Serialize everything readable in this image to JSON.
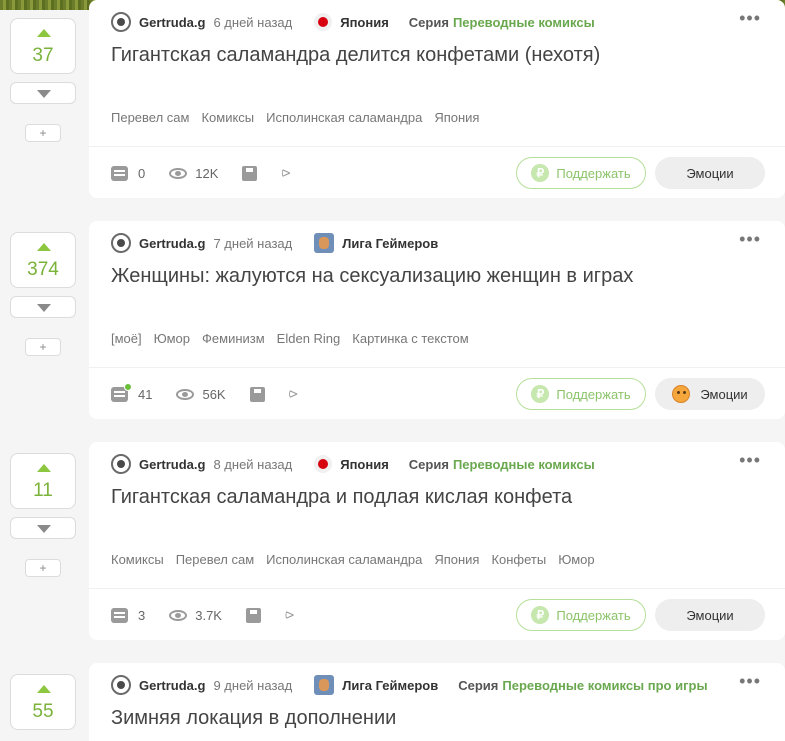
{
  "posts": [
    {
      "score": "37",
      "author": "Gertruda.g",
      "time": "6 дней назад",
      "community": "Япония",
      "community_icon": "japan-flag-icon",
      "series_label": "Серия",
      "series_name": "Переводные комиксы",
      "title": "Гигантская саламандра делится конфетами (нехотя)",
      "tags": [
        "Перевел сам",
        "Комиксы",
        "Исполинская саламандра",
        "Япония"
      ],
      "comments": "0",
      "views": "12K",
      "support_label": "Поддержать",
      "emotions_label": "Эмоции",
      "emotions_icon": ""
    },
    {
      "score": "374",
      "author": "Gertruda.g",
      "time": "7 дней назад",
      "community": "Лига Геймеров",
      "community_icon": "gamer-league-icon",
      "series_label": "",
      "series_name": "",
      "title": "Женщины: жалуются на сексуализацию женщин в играх",
      "tags": [
        "[моё]",
        "Юмор",
        "Феминизм",
        "Elden Ring",
        "Картинка с текстом"
      ],
      "comments": "41",
      "views": "56K",
      "support_label": "Поддержать",
      "emotions_label": "Эмоции",
      "emotions_icon": "laughing-face-icon"
    },
    {
      "score": "11",
      "author": "Gertruda.g",
      "time": "8 дней назад",
      "community": "Япония",
      "community_icon": "japan-flag-icon",
      "series_label": "Серия",
      "series_name": "Переводные комиксы",
      "title": "Гигантская саламандра и подлая кислая конфета",
      "tags": [
        "Комиксы",
        "Перевел сам",
        "Исполинская саламандра",
        "Япония",
        "Конфеты",
        "Юмор"
      ],
      "comments": "3",
      "views": "3.7K",
      "support_label": "Поддержать",
      "emotions_label": "Эмоции",
      "emotions_icon": ""
    },
    {
      "score": "55",
      "author": "Gertruda.g",
      "time": "9 дней назад",
      "community": "Лига Геймеров",
      "community_icon": "gamer-league-icon",
      "series_label": "Серия",
      "series_name": "Переводные комиксы про игры",
      "title": "Зимняя локация в дополнении",
      "tags": [],
      "comments": "",
      "views": "",
      "support_label": "",
      "emotions_label": "",
      "emotions_icon": ""
    }
  ],
  "plus_label": "+",
  "more_glyph": "•••",
  "ruble_glyph": "₽",
  "colors": {
    "accent_green": "#7ab23a",
    "series_link": "#6aa84f",
    "support_border": "#b6df9a"
  }
}
